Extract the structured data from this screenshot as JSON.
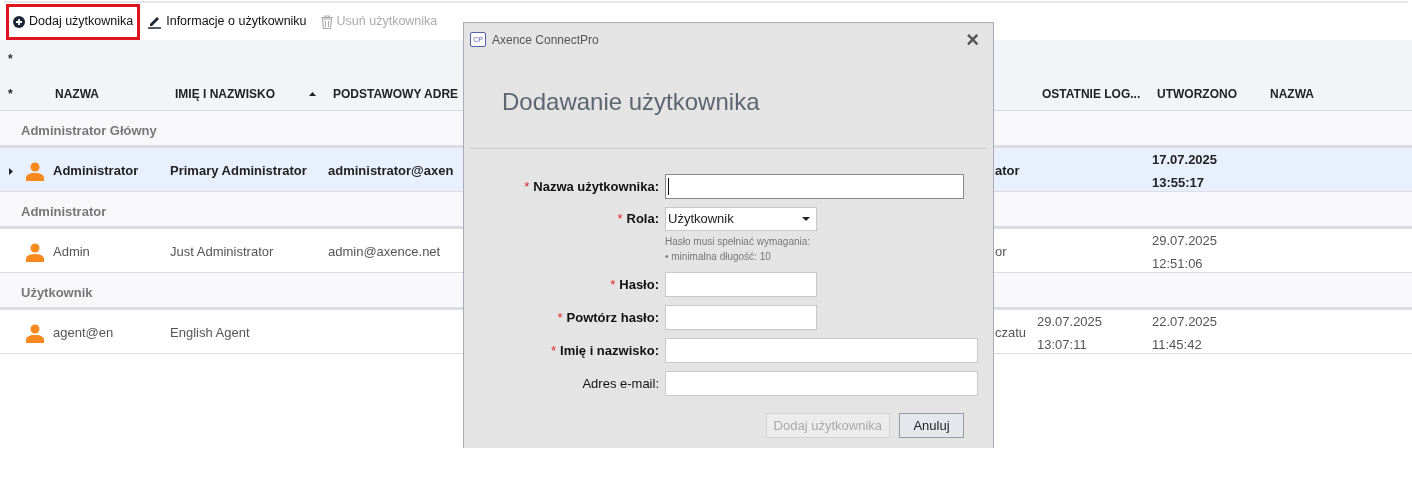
{
  "toolbar": {
    "buttons": [
      {
        "label": "Dodaj użytkownika",
        "disabled": false,
        "highlighted": true
      },
      {
        "label": "Informacje o użytkowniku",
        "disabled": false,
        "highlighted": false
      },
      {
        "label": "Usuń użytkownika",
        "disabled": true,
        "highlighted": false
      }
    ]
  },
  "table": {
    "filter_marker": "*",
    "columns": [
      {
        "label": "*",
        "sorted": false
      },
      {
        "label": "NAZWA",
        "sorted": false
      },
      {
        "label": "IMIĘ I NAZWISKO",
        "sorted": true
      },
      {
        "label": "PODSTAWOWY ADRE",
        "sorted": false
      },
      {
        "label": "OSTATNIE LOG...",
        "sorted": false
      },
      {
        "label": "UTWORZONO",
        "sorted": false
      },
      {
        "label": "NAZWA",
        "sorted": false
      }
    ],
    "groups": [
      {
        "title": "Administrator Główny",
        "rows": [
          {
            "selected": true,
            "name": "Administrator",
            "full_name": "Primary Administrator",
            "email": "administrator@axen",
            "column_5": "ator",
            "last_login": [],
            "created": [
              "17.07.2025",
              "13:55:17"
            ]
          }
        ]
      },
      {
        "title": "Administrator",
        "rows": [
          {
            "selected": false,
            "name": "Admin",
            "full_name": "Just Administrator",
            "email": "admin@axence.net",
            "column_5": "or",
            "last_login": [],
            "created": [
              "29.07.2025",
              "12:51:06"
            ]
          }
        ]
      },
      {
        "title": "Użytkownik",
        "rows": [
          {
            "selected": false,
            "name": "agent@en",
            "full_name": "English Agent",
            "email": "",
            "column_5": "czatu",
            "last_login": [
              "29.07.2025",
              "13:07:11"
            ],
            "created": [
              "22.07.2025",
              "11:45:42"
            ]
          }
        ]
      }
    ]
  },
  "dialog": {
    "app_icon": "CP",
    "title": "Axence ConnectPro",
    "close": "×",
    "heading": "Dodawanie użytkownika",
    "fields": [
      {
        "kind": "text",
        "label": "Nazwa użytkownika:",
        "required": true,
        "focused": true
      },
      {
        "kind": "select",
        "label": "Rola:",
        "required": true,
        "value": "Użytkownik"
      },
      {
        "kind": "hint",
        "lines": [
          "Hasło musi spełniać wymagania:",
          "• minimalna długość: 10"
        ]
      },
      {
        "kind": "password",
        "label": "Hasło:",
        "required": true,
        "focused": false
      },
      {
        "kind": "password",
        "label": "Powtórz hasło:",
        "required": true,
        "focused": false
      },
      {
        "kind": "text",
        "label": "Imię i nazwisko:",
        "required": true,
        "focused": false
      },
      {
        "kind": "text",
        "label": "Adres e-mail:",
        "required": false,
        "focused": false
      }
    ],
    "buttons": [
      {
        "label": "Dodaj użytkownika",
        "disabled": true
      },
      {
        "label": "Anuluj",
        "disabled": false
      }
    ]
  }
}
